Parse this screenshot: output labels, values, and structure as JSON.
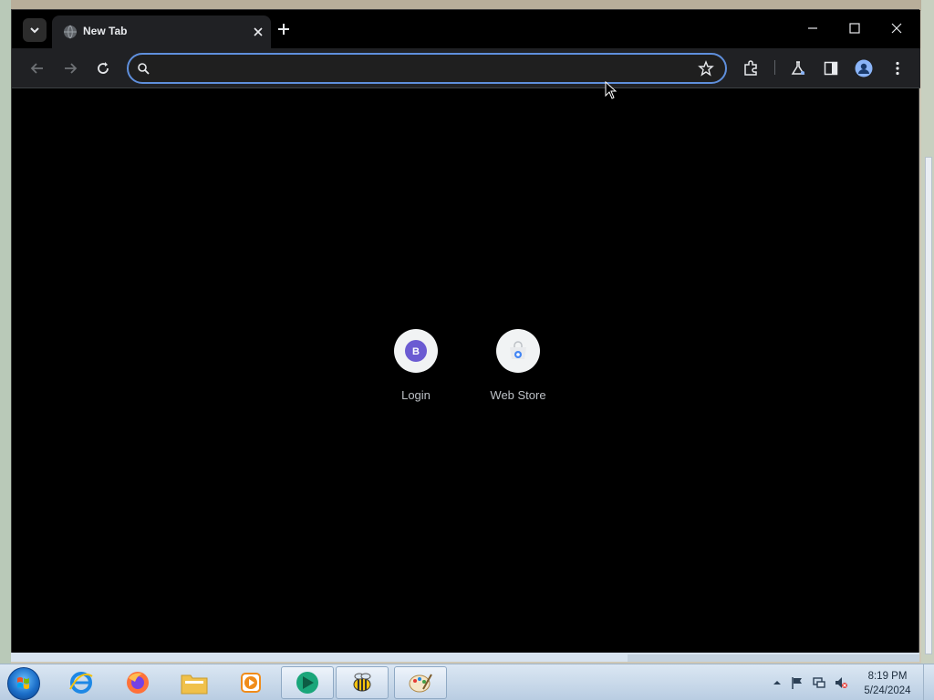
{
  "browser": {
    "tab": {
      "title": "New Tab"
    },
    "omnibox": {
      "value": "",
      "placeholder": ""
    }
  },
  "new_tab_page": {
    "shortcuts": [
      {
        "label": "Login",
        "initial": "B",
        "color": "#6b5bd2"
      },
      {
        "label": "Web Store",
        "icon": "web-store-icon"
      }
    ]
  },
  "taskbar": {
    "apps": [
      "internet-explorer-icon",
      "firefox-icon",
      "file-explorer-icon",
      "media-player-icon",
      "green-app-icon",
      "bee-app-icon",
      "paint-icon"
    ],
    "clock": {
      "time": "8:19 PM",
      "date": "5/24/2024"
    }
  },
  "colors": {
    "omnibox_focus": "#5f8fdc",
    "avatar": "#8ab4f8",
    "taskbar": "#c8d8ea"
  }
}
